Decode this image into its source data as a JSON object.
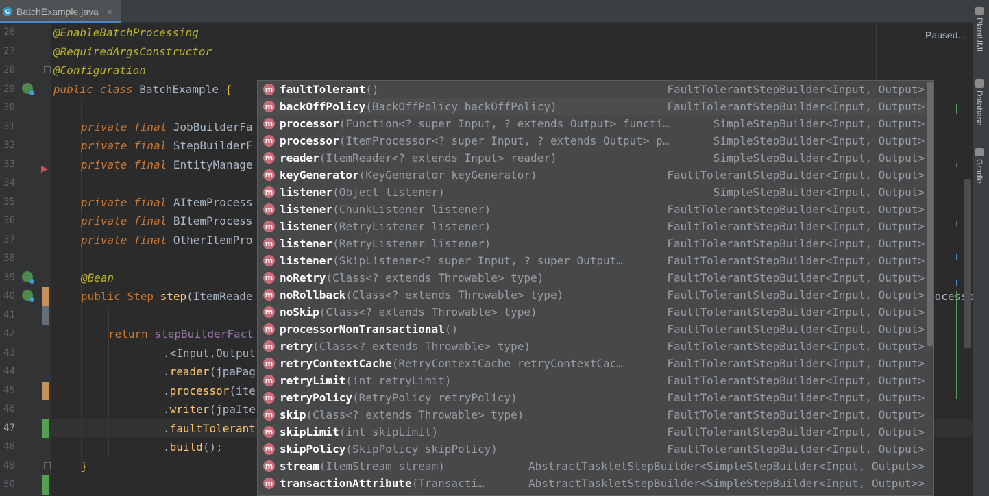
{
  "tab": {
    "icon_letter": "C",
    "filename": "BatchExample.java",
    "close": "×"
  },
  "status": {
    "paused": "Paused..."
  },
  "right_tools": [
    {
      "label": "PlantUML",
      "icon": "plantuml-icon"
    },
    {
      "label": "Database",
      "icon": "database-icon"
    },
    {
      "label": "Gradle",
      "icon": "gradle-icon"
    }
  ],
  "line_numbers": [
    "26",
    "27",
    "28",
    "29",
    "30",
    "31",
    "32",
    "33",
    "34",
    "35",
    "36",
    "37",
    "38",
    "39",
    "40",
    "41",
    "42",
    "43",
    "44",
    "45",
    "46",
    "47",
    "48",
    "49",
    "50"
  ],
  "current_line": "47",
  "code": {
    "l26": "@EnableBatchProcessing",
    "l27": "@RequiredArgsConstructor",
    "l28": "@Configuration",
    "l29_kw1": "public",
    "l29_kw2": "class",
    "l29_name": "BatchExample",
    "l29_brace": "{",
    "l31_mod": "private final",
    "l31_rest": "JobBuilderFa",
    "l32_mod": "private final",
    "l32_rest": "StepBuilderF",
    "l33_mod": "private final",
    "l33_rest": "EntityManage",
    "l35_mod": "private final",
    "l35_rest": "AItemProcess",
    "l36_mod": "private final",
    "l36_rest": "BItemProcess",
    "l37_mod": "private final",
    "l37_rest": "OtherItemPro",
    "l39": "@Bean",
    "l40_kw": "public",
    "l40_type": "Step",
    "l40_method": "step",
    "l40_rest": "(ItemReade",
    "l40_tail": "rocesso",
    "l42_kw": "return",
    "l42_field": "stepBuilderFact",
    "l43": ".<Input,Output",
    "l44_dot": ".",
    "l44_m": "reader",
    "l44_rest": "(jpaPag",
    "l45_dot": ".",
    "l45_m": "processor",
    "l45_rest": "(ite",
    "l46_dot": ".",
    "l46_m": "writer",
    "l46_rest": "(jpaIte",
    "l47_dot": ".",
    "l47_m": "faultTolerant",
    "l48_dot": ".",
    "l48_m": "build",
    "l48_rest": "();",
    "l49": "}"
  },
  "completion": {
    "icon_letter": "m",
    "items": [
      {
        "name": "faultTolerant",
        "sig": "()",
        "type": "FaultTolerantStepBuilder<Input, Output>"
      },
      {
        "name": "backOffPolicy",
        "sig": "(BackOffPolicy backOffPolicy)",
        "type": "FaultTolerantStepBuilder<Input, Output>"
      },
      {
        "name": "processor",
        "sig": "(Function<? super Input, ? extends Output> functi…",
        "type": "SimpleStepBuilder<Input, Output>"
      },
      {
        "name": "processor",
        "sig": "(ItemProcessor<? super Input, ? extends Output> p…",
        "type": "SimpleStepBuilder<Input, Output>"
      },
      {
        "name": "reader",
        "sig": "(ItemReader<? extends Input> reader)",
        "type": "SimpleStepBuilder<Input, Output>"
      },
      {
        "name": "keyGenerator",
        "sig": "(KeyGenerator keyGenerator)",
        "type": "FaultTolerantStepBuilder<Input, Output>"
      },
      {
        "name": "listener",
        "sig": "(Object listener)",
        "type": "SimpleStepBuilder<Input, Output>"
      },
      {
        "name": "listener",
        "sig": "(ChunkListener listener)",
        "type": "FaultTolerantStepBuilder<Input, Output>"
      },
      {
        "name": "listener",
        "sig": "(RetryListener listener)",
        "type": "FaultTolerantStepBuilder<Input, Output>"
      },
      {
        "name": "listener",
        "sig": "(RetryListener listener)",
        "type": "FaultTolerantStepBuilder<Input, Output>"
      },
      {
        "name": "listener",
        "sig": "(SkipListener<? super Input, ? super Output…",
        "type": "FaultTolerantStepBuilder<Input, Output>"
      },
      {
        "name": "noRetry",
        "sig": "(Class<? extends Throwable> type)",
        "type": "FaultTolerantStepBuilder<Input, Output>"
      },
      {
        "name": "noRollback",
        "sig": "(Class<? extends Throwable> type)",
        "type": "FaultTolerantStepBuilder<Input, Output>"
      },
      {
        "name": "noSkip",
        "sig": "(Class<? extends Throwable> type)",
        "type": "FaultTolerantStepBuilder<Input, Output>"
      },
      {
        "name": "processorNonTransactional",
        "sig": "()",
        "type": "FaultTolerantStepBuilder<Input, Output>"
      },
      {
        "name": "retry",
        "sig": "(Class<? extends Throwable> type)",
        "type": "FaultTolerantStepBuilder<Input, Output>"
      },
      {
        "name": "retryContextCache",
        "sig": "(RetryContextCache retryContextCac…",
        "type": "FaultTolerantStepBuilder<Input, Output>"
      },
      {
        "name": "retryLimit",
        "sig": "(int retryLimit)",
        "type": "FaultTolerantStepBuilder<Input, Output>"
      },
      {
        "name": "retryPolicy",
        "sig": "(RetryPolicy retryPolicy)",
        "type": "FaultTolerantStepBuilder<Input, Output>"
      },
      {
        "name": "skip",
        "sig": "(Class<? extends Throwable> type)",
        "type": "FaultTolerantStepBuilder<Input, Output>"
      },
      {
        "name": "skipLimit",
        "sig": "(int skipLimit)",
        "type": "FaultTolerantStepBuilder<Input, Output>"
      },
      {
        "name": "skipPolicy",
        "sig": "(SkipPolicy skipPolicy)",
        "type": "FaultTolerantStepBuilder<Input, Output>"
      },
      {
        "name": "stream",
        "sig": "(ItemStream stream)",
        "type": "AbstractTaskletStepBuilder<SimpleStepBuilder<Input, Output>>"
      },
      {
        "name": "transactionAttribute",
        "sig": "(Transacti…",
        "type": "AbstractTaskletStepBuilder<SimpleStepBuilder<Input, Output>>"
      }
    ]
  },
  "colors": {
    "editor_bg": "#2b2b2b",
    "gutter_bg": "#313335",
    "popup_bg": "#46484a",
    "method_icon": "#cc6b78",
    "tab_accent": "#4a88c7",
    "change_added": "#549e54",
    "change_modified": "#c7915e",
    "change_deleted": "#656e76"
  }
}
